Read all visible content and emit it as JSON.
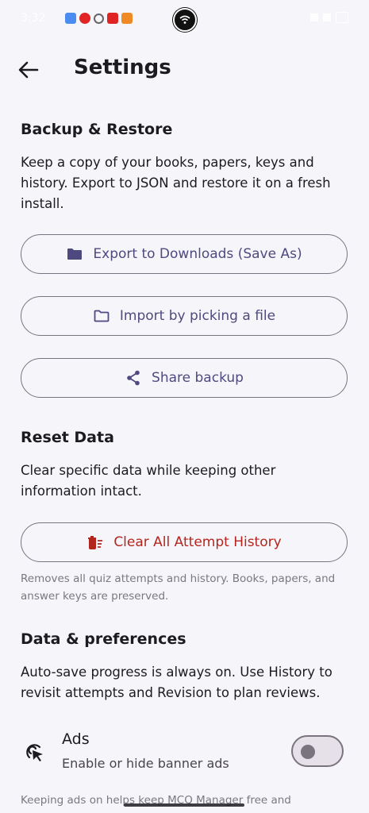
{
  "status_bar": {
    "time": "3:32",
    "notification_icons": [
      "play-icon",
      "pinterest-icon",
      "threads-icon",
      "youtube-icon",
      "square-icon"
    ],
    "center_icon": "wifi-badge-icon"
  },
  "header": {
    "title": "Settings",
    "back_icon": "arrow-back-icon"
  },
  "backup_restore": {
    "title": "Backup & Restore",
    "description": "Keep a copy of your books, papers, keys and history. Export to JSON and restore it on a fresh install.",
    "buttons": [
      {
        "label": "Export to Downloads (Save As)",
        "icon": "folder-filled-icon"
      },
      {
        "label": "Import by picking a file",
        "icon": "folder-outline-icon"
      },
      {
        "label": "Share backup",
        "icon": "share-icon"
      }
    ]
  },
  "reset_data": {
    "title": "Reset Data",
    "description": "Clear specific data while keeping other information intact.",
    "clear_button": {
      "label": "Clear All Attempt History",
      "icon": "delete-sweep-icon"
    },
    "note": "Removes all quiz attempts and history. Books, papers, and answer keys are preserved."
  },
  "data_preferences": {
    "title": "Data & preferences",
    "description": "Auto-save progress is always on. Use History to revisit attempts and Revision to plan reviews.",
    "ads": {
      "title": "Ads",
      "subtitle": "Enable or hide banner ads",
      "icon": "ads-click-icon",
      "enabled": false
    },
    "footer_note": "Keeping ads on helps keep MCQ Manager free and"
  },
  "colors": {
    "background": "#F6F5FA",
    "accent": "#4E4A80",
    "danger": "#B3261E",
    "outline": "#77757F"
  }
}
